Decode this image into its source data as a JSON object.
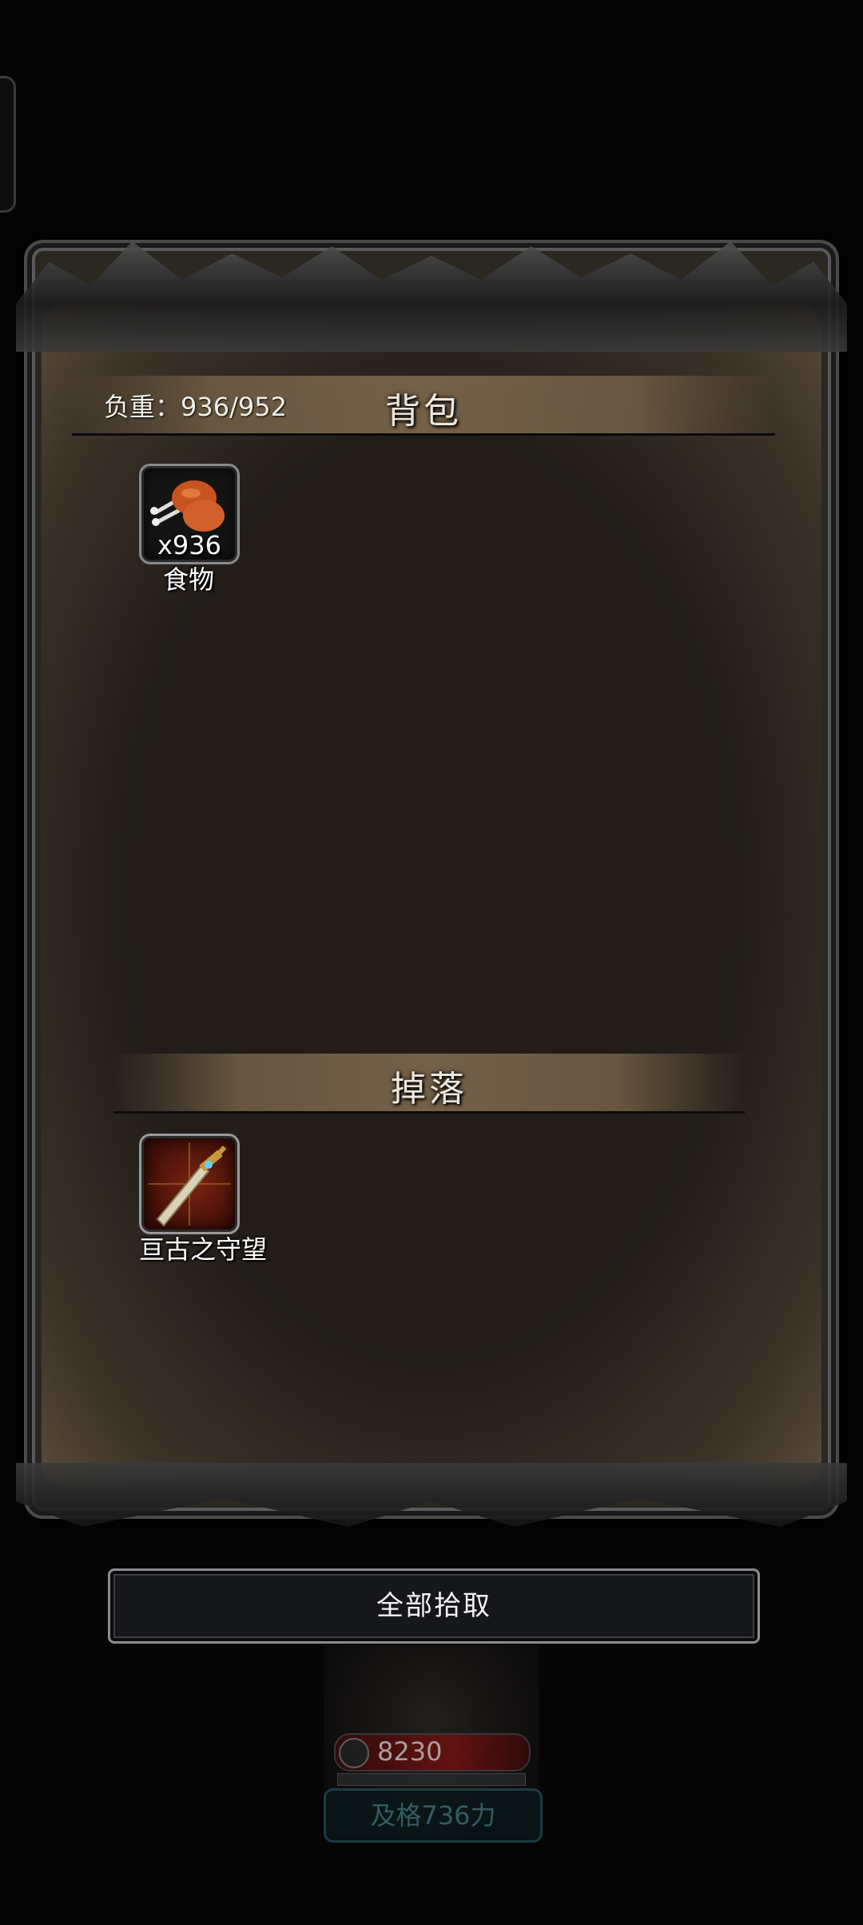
{
  "bag": {
    "weight_text": "负重：936/952",
    "title": "背包",
    "items": [
      {
        "quantity": "x936",
        "name": "食物",
        "icon": "drumstick-icon"
      }
    ]
  },
  "drops": {
    "title": "掉落",
    "items": [
      {
        "name": "亘古之守望",
        "icon": "sword-icon"
      }
    ]
  },
  "actions": {
    "pickup_all": "全部拾取"
  },
  "hero": {
    "power": "8230",
    "qualify_text": "及格736力"
  },
  "colors": {
    "panel_bg": "#221d19",
    "header_band": "#78644a",
    "button_bg": "#15171a",
    "power_bar": "#7a1010",
    "qualify_text": "#3e6f78"
  }
}
